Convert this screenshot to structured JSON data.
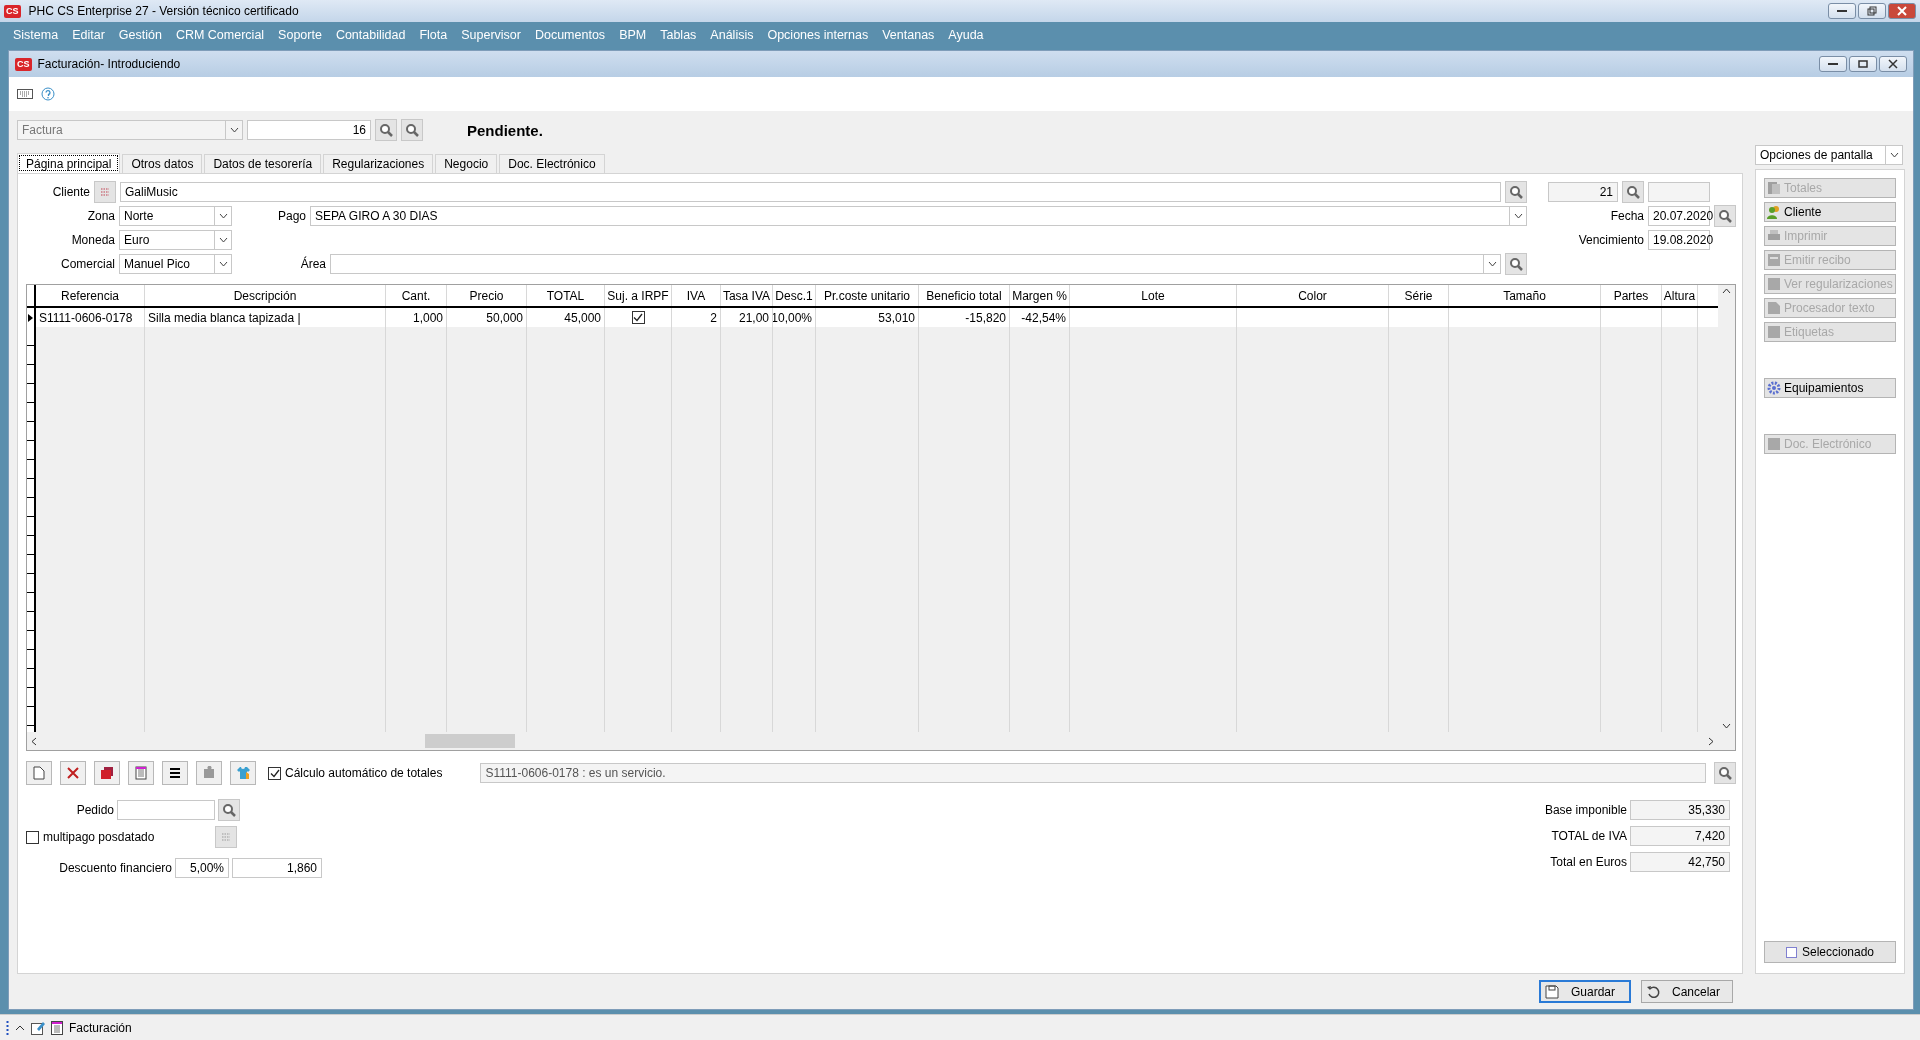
{
  "app": {
    "logo": "CS",
    "title": "PHC CS Enterprise 27 - Versión técnico certificado"
  },
  "menu": [
    "Sistema",
    "Editar",
    "Gestión",
    "CRM Comercial",
    "Soporte",
    "Contabilidad",
    "Flota",
    "Supervisor",
    "Documentos",
    "BPM",
    "Tablas",
    "Análisis",
    "Opciones internas",
    "Ventanas",
    "Ayuda"
  ],
  "window": {
    "logo": "CS",
    "title": "Facturación- Introduciendo"
  },
  "document": {
    "type": "Factura",
    "number": "16",
    "status": "Pendiente."
  },
  "tabs": [
    {
      "label": "Página principal",
      "selected": true
    },
    {
      "label": "Otros datos",
      "selected": false
    },
    {
      "label": "Datos de tesorería",
      "selected": false
    },
    {
      "label": "Regularizaciones",
      "selected": false
    },
    {
      "label": "Negocio",
      "selected": false
    },
    {
      "label": "Doc. Electrónico",
      "selected": false
    }
  ],
  "form": {
    "cliente": {
      "label": "Cliente",
      "value": "GaliMusic",
      "number": "21"
    },
    "zona": {
      "label": "Zona",
      "value": "Norte"
    },
    "pago": {
      "label": "Pago",
      "value": "SEPA GIRO A 30 DIAS"
    },
    "fecha": {
      "label": "Fecha",
      "value": "20.07.2020"
    },
    "moneda": {
      "label": "Moneda",
      "value": "Euro"
    },
    "vencimiento": {
      "label": "Vencimiento",
      "value": "19.08.2020"
    },
    "comercial": {
      "label": "Comercial",
      "value": "Manuel Pico"
    },
    "area": {
      "label": "Área"
    }
  },
  "grid": {
    "columns": [
      "Referencia",
      "Descripción",
      "Cant.",
      "Precio",
      "TOTAL",
      "Suj. a IRPF",
      "IVA",
      "Tasa IVA",
      "Desc.1",
      "Pr.coste unitario",
      "Beneficio total",
      "Margen %",
      "Lote",
      "Color",
      "Série",
      "Tamaño",
      "Partes",
      "Altura"
    ],
    "rows": [
      {
        "selected": true,
        "cells": [
          {
            "kind": "text",
            "text": "S1111-0606-0178"
          },
          {
            "kind": "text",
            "text": "Silla media blanca tapizada |"
          },
          {
            "kind": "number",
            "text": "1,000"
          },
          {
            "kind": "number",
            "text": "50,000"
          },
          {
            "kind": "number",
            "text": "45,000"
          },
          {
            "kind": "check",
            "checked": true
          },
          {
            "kind": "number",
            "text": "2"
          },
          {
            "kind": "number",
            "text": "21,00"
          },
          {
            "kind": "number",
            "text": "10,00%"
          },
          {
            "kind": "number",
            "text": "53,010"
          },
          {
            "kind": "number",
            "text": "-15,820"
          },
          {
            "kind": "number",
            "text": "-42,54%"
          }
        ]
      }
    ]
  },
  "auto_totals": {
    "label": "Cálculo automático de totales",
    "checked": true
  },
  "message": "S1111-0606-0178 : es un servicio.",
  "pedido": {
    "label": "Pedido"
  },
  "multipago": {
    "label": "multipago posdatado",
    "checked": false
  },
  "descuento": {
    "label": "Descuento financiero",
    "percent": "5,00%",
    "amount": "1,860"
  },
  "totals": [
    {
      "label": "Base imponible",
      "value": "35,330"
    },
    {
      "label": "TOTAL de IVA",
      "value": "7,420"
    },
    {
      "label": "Total en Euros",
      "value": "42,750"
    }
  ],
  "sidebar": {
    "dropdown": "Opciones de pantalla",
    "groups": [
      [
        {
          "label": "Totales",
          "kind": "totals",
          "disabled": true
        },
        {
          "label": "Cliente",
          "kind": "client",
          "disabled": false
        },
        {
          "label": "Imprimir",
          "kind": "print",
          "disabled": true
        },
        {
          "label": "Emitir recibo",
          "kind": "receipt",
          "disabled": true
        },
        {
          "label": "Ver regularizaciones",
          "kind": "doc",
          "disabled": true
        },
        {
          "label": "Procesador texto",
          "kind": "page",
          "disabled": true
        },
        {
          "label": "Etiquetas",
          "kind": "doc",
          "disabled": true
        }
      ],
      [
        {
          "label": "Equipamientos",
          "kind": "gear",
          "disabled": false
        }
      ],
      [
        {
          "label": "Doc. Electrónico",
          "kind": "doc",
          "disabled": true
        }
      ]
    ],
    "toggle": {
      "label": "Seleccionado",
      "checked": false
    }
  },
  "actions": [
    {
      "label": "Guardar",
      "kind": "save",
      "default": true
    },
    {
      "label": "Cancelar",
      "kind": "cancel",
      "default": false
    }
  ],
  "taskbar": [
    {
      "label": "Facturación"
    }
  ]
}
